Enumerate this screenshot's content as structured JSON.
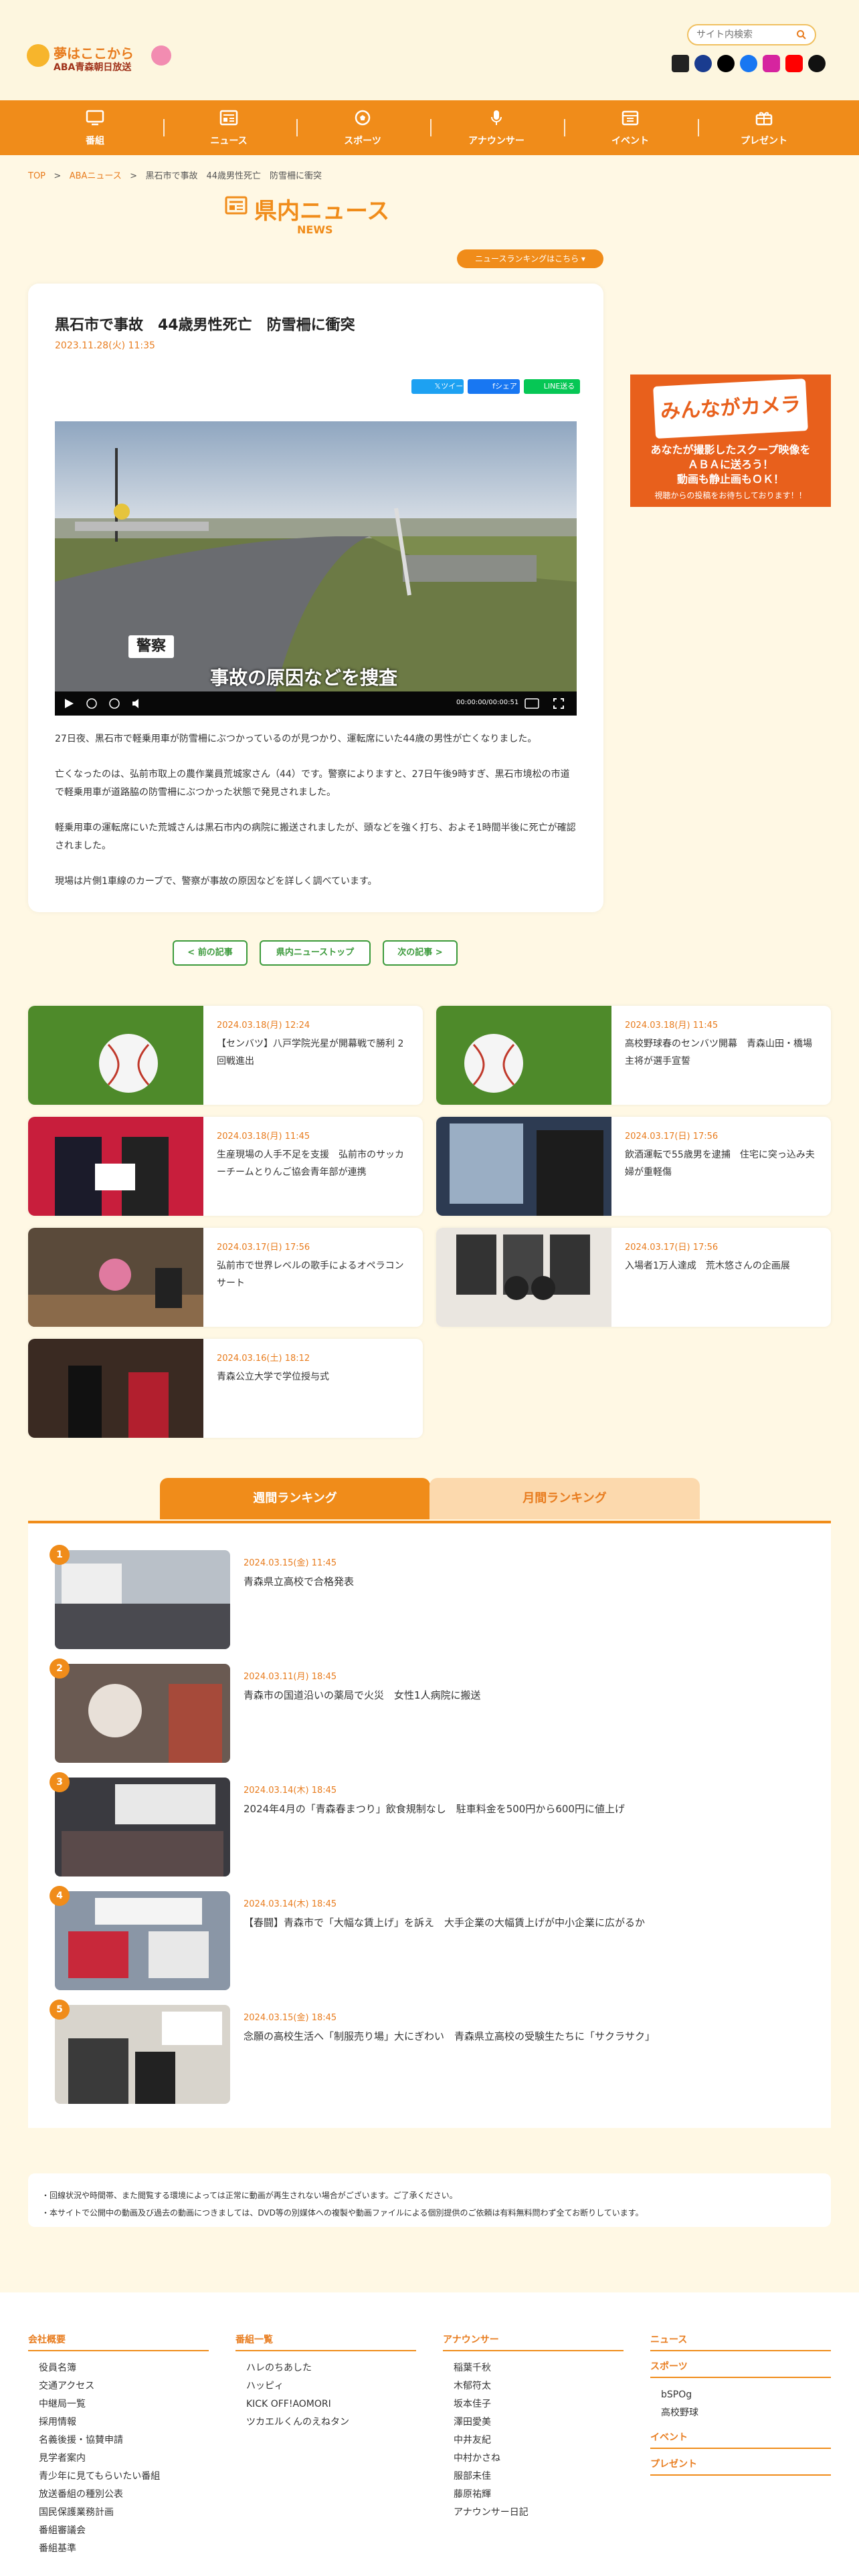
{
  "header": {
    "logo_line1": "夢はここから",
    "logo_line2": "ABA青森朝日放送",
    "search_placeholder": "サイト内検索"
  },
  "nav": {
    "items": [
      {
        "label": "番組",
        "icon": "tv-icon"
      },
      {
        "label": "ニュース",
        "icon": "newspaper-icon"
      },
      {
        "label": "スポーツ",
        "icon": "soccer-ball-icon"
      },
      {
        "label": "アナウンサー",
        "icon": "microphone-icon"
      },
      {
        "label": "イベント",
        "icon": "calendar-icon"
      },
      {
        "label": "プレゼント",
        "icon": "gift-icon"
      }
    ]
  },
  "breadcrumb": {
    "top": "TOP",
    "sep": ">",
    "section": "ABAニュース",
    "current": "黒石市で事故　44歳男性死亡　防雪柵に衝突"
  },
  "page_title": {
    "title": "県内ニュース",
    "subtitle": "NEWS",
    "ranking_link": "ニュースランキングはこちら"
  },
  "article": {
    "title": "黒石市で事故　44歳男性死亡　防雪柵に衝突",
    "date": "2023.11.28(火) 11:35",
    "share_tweet": "ツイート",
    "share_fb": "シェア",
    "share_line": "送る",
    "video_caption_tag": "警察",
    "video_caption": "事故の原因などを捜査",
    "video_time": "00:00:00/00:00:51",
    "paragraphs": [
      "27日夜、黒石市で軽乗用車が防雪柵にぶつかっているのが見つかり、運転席にいた44歳の男性が亡くなりました。",
      "亡くなったのは、弘前市取上の農作業員荒城家さん（44）です。警察によりますと、27日午後9時すぎ、黒石市境松の市道で軽乗用車が道路脇の防雪柵にぶつかった状態で発見されました。",
      "軽乗用車の運転席にいた荒城さんは黒石市内の病院に搬送されましたが、頭などを強く打ち、およそ1時間半後に死亡が確認されました。",
      "現場は片側1車線のカーブで、警察が事故の原因などを詳しく調べています。"
    ]
  },
  "banner": {
    "main": "みんながカメラマン",
    "line1": "あなたが撮影したスクープ映像を",
    "line2": "ＡＢＡに送ろう！",
    "line3": "動画も静止画もＯＫ！",
    "line4": "視聴からの投稿をお待ちしております！！"
  },
  "pager": {
    "prev": "< 前の記事",
    "top": "県内ニューストップ",
    "next": "次の記事 >"
  },
  "news_list": [
    {
      "date": "2024.03.18(月) 12:24",
      "title": "【センバツ】八戸学院光星が開幕戦で勝利 2回戦進出"
    },
    {
      "date": "2024.03.18(月) 11:45",
      "title": "高校野球春のセンバツ開幕　青森山田・橋場主将が選手宣誓"
    },
    {
      "date": "2024.03.18(月) 11:45",
      "title": "生産現場の人手不足を支援　弘前市のサッカーチームとりんご協会青年部が連携"
    },
    {
      "date": "2024.03.17(日) 17:56",
      "title": "飲酒運転で55歳男を逮捕　住宅に突っ込み夫婦が重軽傷"
    },
    {
      "date": "2024.03.17(日) 17:56",
      "title": "弘前市で世界レベルの歌手によるオペラコンサート"
    },
    {
      "date": "2024.03.17(日) 17:56",
      "title": "入場者1万人達成　荒木悠さんの企画展"
    },
    {
      "date": "2024.03.16(土) 18:12",
      "title": "青森公立大学で学位授与式"
    }
  ],
  "ranking": {
    "tab_weekly": "週間ランキング",
    "tab_monthly": "月間ランキング",
    "items": [
      {
        "rank": "1",
        "date": "2024.03.15(金) 11:45",
        "title": "青森県立高校で合格発表"
      },
      {
        "rank": "2",
        "date": "2024.03.11(月) 18:45",
        "title": "青森市の国道沿いの薬局で火災　女性1人病院に搬送"
      },
      {
        "rank": "3",
        "date": "2024.03.14(木) 18:45",
        "title": "2024年4月の「青森春まつり」飲食規制なし　駐車料金を500円から600円に値上げ"
      },
      {
        "rank": "4",
        "date": "2024.03.14(木) 18:45",
        "title": "【春闘】青森市で「大幅な賃上げ」を訴え　大手企業の大幅賃上げが中小企業に広がるか"
      },
      {
        "rank": "5",
        "date": "2024.03.15(金) 18:45",
        "title": "念願の高校生活へ「制服売り場」大にぎわい　青森県立高校の受験生たちに「サクラサク」"
      }
    ]
  },
  "notes": {
    "line1": "・回線状況や時間帯、また閲覧する環境によっては正常に動画が再生されない場合がございます。ご了承ください。",
    "line2": "・本サイトで公開中の動画及び過去の動画につきましては、DVD等の別媒体への複製や動画ファイルによる個別提供のご依頼は有料無料問わず全てお断りしています。"
  },
  "footer": {
    "col1": {
      "heading": "会社概要",
      "links": [
        "役員名簿",
        "交通アクセス",
        "中継局一覧",
        "採用情報",
        "名義後援・協賛申請",
        "見学者案内",
        "青少年に見てもらいたい番組",
        "放送番組の種別公表",
        "国民保護業務計画",
        "番組審議会",
        "番組基準"
      ]
    },
    "col2": {
      "heading": "番組一覧",
      "links": [
        "ハレのちあした",
        "ハッピィ",
        "KICK OFF!AOMORI",
        "ツカエルくんのえねタン"
      ]
    },
    "col3": {
      "heading": "アナウンサー",
      "links": [
        "稲葉千秋",
        "木郁符太",
        "坂本佳子",
        "澤田愛美",
        "中井友紀",
        "中村かさね",
        "服部未佳",
        "藤原祐輝",
        "アナウンサー日記"
      ]
    },
    "col4": {
      "heading": "ニュース",
      "sports": "スポーツ",
      "sports_links": [
        "bSPOg",
        "高校野球"
      ],
      "event": "イベント",
      "present": "プレゼント"
    }
  },
  "colors": {
    "accent": "#f08c1a",
    "green": "#3b9a3b",
    "bg": "#fff8e4"
  }
}
